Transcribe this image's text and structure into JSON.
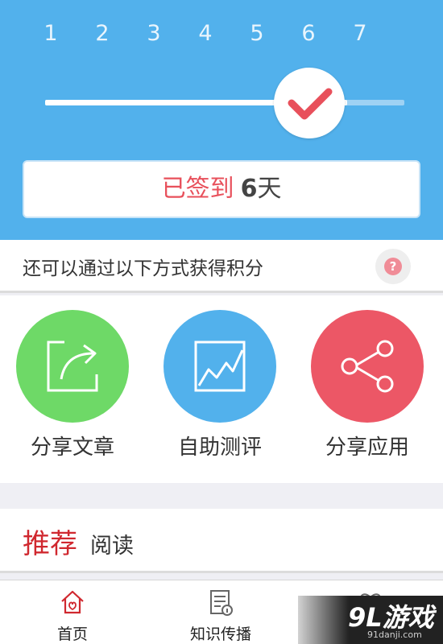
{
  "header": {
    "days": [
      "1",
      "2",
      "3",
      "4",
      "5",
      "6",
      "7"
    ],
    "progress_days": 6,
    "total_days": 7,
    "signed_prefix": "已签到",
    "signed_count": "6",
    "signed_suffix": "天"
  },
  "hint": {
    "text": "还可以通过以下方式获得积分",
    "help_glyph": "?"
  },
  "actions": [
    {
      "label": "分享文章",
      "icon": "share-article-icon",
      "color": "#6ed967"
    },
    {
      "label": "自助测评",
      "icon": "chart-icon",
      "color": "#52b1ec"
    },
    {
      "label": "分享应用",
      "icon": "share-icon",
      "color": "#ec5766"
    }
  ],
  "recommend": {
    "title": "推荐",
    "subtitle": "阅读"
  },
  "tabs": [
    {
      "label": "首页",
      "icon": "home-icon",
      "active": true
    },
    {
      "label": "知识传播",
      "icon": "knowledge-icon",
      "active": false
    }
  ],
  "watermark": {
    "text": "9L游戏",
    "sub": "91danji.com"
  },
  "colors": {
    "header_bg": "#52b1ec",
    "accent_red": "#e8505b",
    "title_red": "#d0282f"
  }
}
